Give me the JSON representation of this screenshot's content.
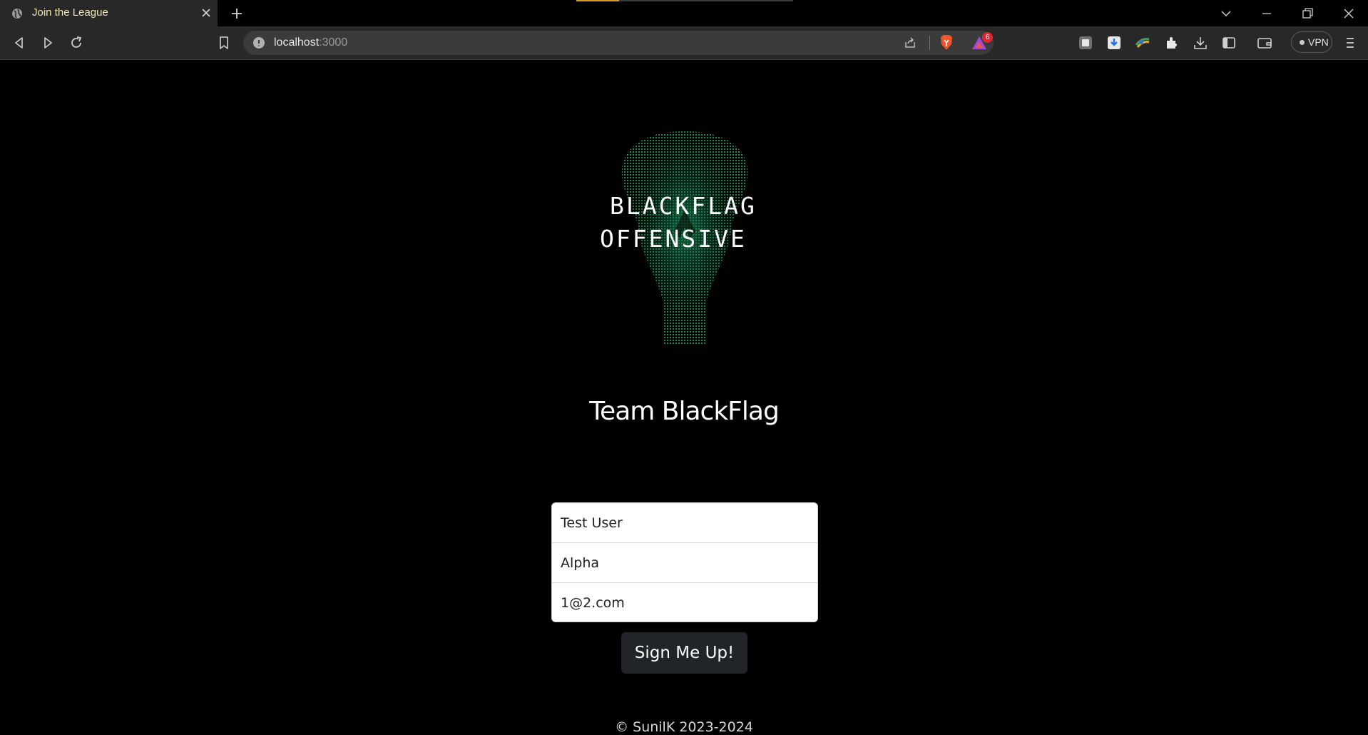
{
  "browser": {
    "tab": {
      "title": "Join the League",
      "favicon": "globe-icon"
    },
    "address": {
      "host": "localhost",
      "port": ":3000"
    },
    "shields_badge": "6",
    "vpn_label": "VPN",
    "colors": {
      "tab_title": "#f3e6b3",
      "loading_bar": "#d79a2b",
      "toolbar": "#282828"
    }
  },
  "page": {
    "logo": {
      "line1": "BLACKFLAG",
      "line2": "OFFENSIVE"
    },
    "heading": "Team BlackFlag",
    "form": {
      "name_value": "Test User",
      "team_value": "Alpha",
      "email_value": "1@2.com",
      "submit_label": "Sign Me Up!"
    },
    "footer": "© SunilK 2023-2024"
  }
}
